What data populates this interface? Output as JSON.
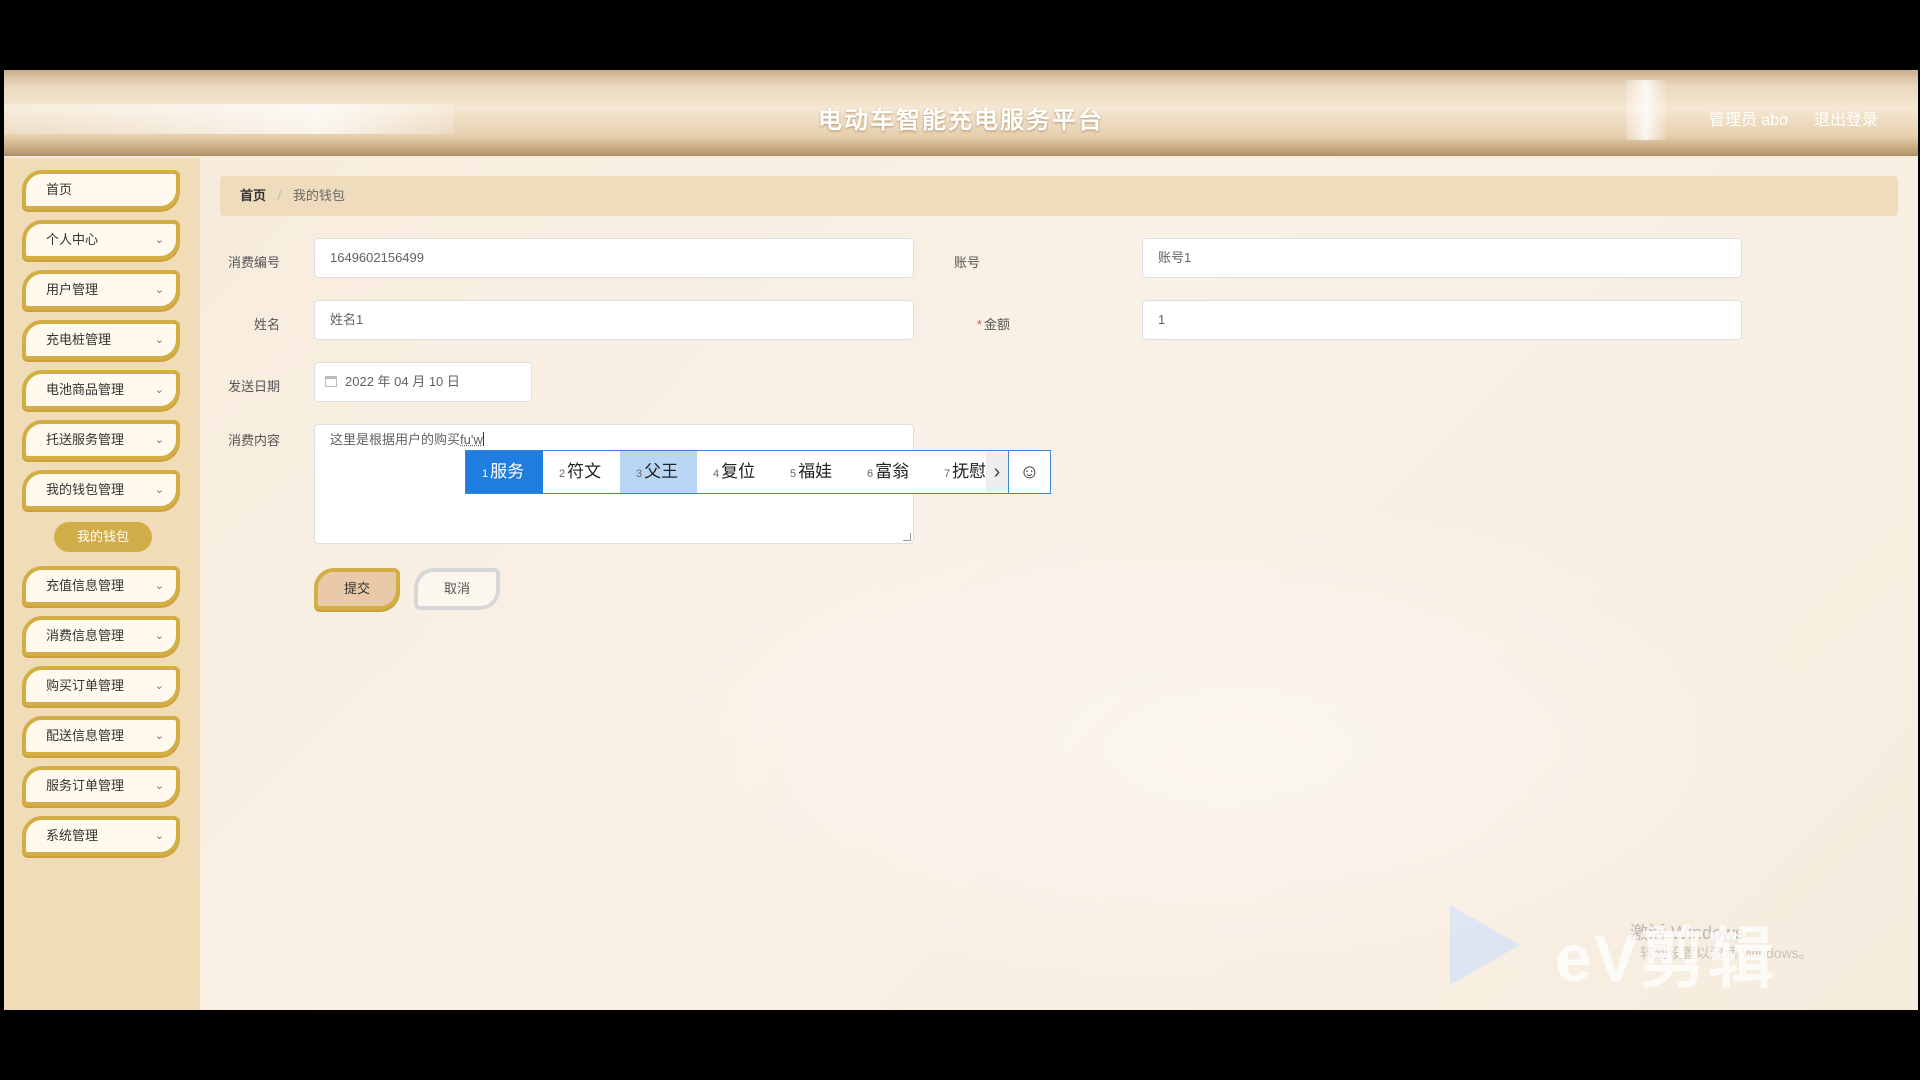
{
  "header": {
    "title": "电动车智能充电服务平台",
    "user": "管理员 abo",
    "logout": "退出登录"
  },
  "sidebar": {
    "items": [
      {
        "label": "首页",
        "chevron": false
      },
      {
        "label": "个人中心",
        "chevron": true
      },
      {
        "label": "用户管理",
        "chevron": true
      },
      {
        "label": "充电桩管理",
        "chevron": true
      },
      {
        "label": "电池商品管理",
        "chevron": true
      },
      {
        "label": "托送服务管理",
        "chevron": true
      },
      {
        "label": "我的钱包管理",
        "chevron": true
      },
      {
        "label": "充值信息管理",
        "chevron": true
      },
      {
        "label": "消费信息管理",
        "chevron": true
      },
      {
        "label": "购买订单管理",
        "chevron": true
      },
      {
        "label": "配送信息管理",
        "chevron": true
      },
      {
        "label": "服务订单管理",
        "chevron": true
      },
      {
        "label": "系统管理",
        "chevron": true
      }
    ],
    "submenu": {
      "label": "我的钱包"
    },
    "chevron_icon": "chevron-down-icon"
  },
  "breadcrumb": {
    "home": "首页",
    "separator": "/",
    "current": "我的钱包"
  },
  "form": {
    "consume_no": {
      "label": "消费编号",
      "value": "1649602156499"
    },
    "account": {
      "label": "账号",
      "value": "账号1"
    },
    "name": {
      "label": "姓名",
      "value": "姓名1"
    },
    "amount": {
      "label": "金额",
      "value": "1",
      "required_mark": "*"
    },
    "send_date": {
      "label": "发送日期",
      "value": "2022 年 04 月 10 日"
    },
    "content": {
      "label": "消费内容",
      "value": "这里是根据用户的购买",
      "composing": "fu'w"
    },
    "submit": "提交",
    "cancel": "取消"
  },
  "ime": {
    "candidates": [
      {
        "num": "1",
        "text": "服务"
      },
      {
        "num": "2",
        "text": "符文"
      },
      {
        "num": "3",
        "text": "父王"
      },
      {
        "num": "4",
        "text": "复位"
      },
      {
        "num": "5",
        "text": "福娃"
      },
      {
        "num": "6",
        "text": "富翁"
      },
      {
        "num": "7",
        "text": "抚慰"
      }
    ],
    "next": "›",
    "emoji": "☺"
  },
  "watermark": {
    "brand": "eV剪辑",
    "activate": "激活 Windows",
    "activate_sub": "转到设置以激活 Windows。"
  },
  "colors": {
    "accent_gold": "#d3ae45",
    "sidebar_bg": "#f1dcb8",
    "ime_active": "#1f7de0"
  }
}
